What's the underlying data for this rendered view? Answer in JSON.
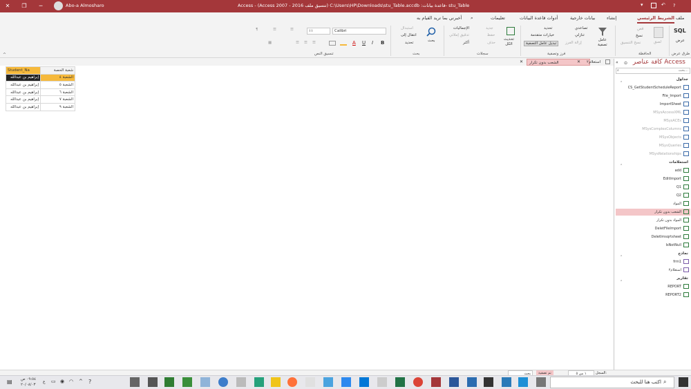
{
  "titlebar": {
    "title": "Access  -  (Access 2007 - 2016 تنسيق ملف) C:\\Users\\HP\\Downloads\\stu_Table.accdb :قاعدة بيانات- stu_Table",
    "user": "Abo-a Almosharo",
    "help": "?"
  },
  "menu": {
    "file": "ملف",
    "home": "الشريط الرئيسي",
    "create": "إنشاء",
    "external": "بيانات خارجية",
    "dbtools": "أدوات قاعدة البيانات",
    "help": "تعليمات",
    "tellme": "أخبرني بما تريد القيام به"
  },
  "ribbon": {
    "views": {
      "label": "طرق عرض",
      "view": "عرض",
      "sql": "SQL"
    },
    "clipboard": {
      "label": "الحافظة",
      "paste": "لصق",
      "cut": "قص",
      "copy": "نسخ",
      "format": "نسخ التنسيق"
    },
    "sortfilter": {
      "label": "فرز وتصفية",
      "filter": "عامل\nتصفية",
      "asc": "تصاعدي",
      "desc": "تنازلي",
      "remove_sort": "إزالة الفرز",
      "selection": "تحديد",
      "advanced": "خيارات متقدمة",
      "toggle": "تبديل عامل التصفية"
    },
    "records": {
      "label": "سجلات",
      "refresh": "تحديث\nالكل",
      "new": "جديد",
      "save": "حفظ",
      "delete": "حذف",
      "totals": "الإجماليات",
      "spelling": "تدقيق إملائي",
      "more": "أكثر"
    },
    "find": {
      "label": "بحث",
      "find": "بحث",
      "replace": "استبدال",
      "goto": "انتقال إلى",
      "select": "تحديد"
    },
    "textformat": {
      "label": "تنسيق النص",
      "font": "Calibri",
      "size": "١١"
    }
  },
  "doctabs": {
    "tab1": "الشعب بدون تكرار",
    "tab2": "استعلام٢"
  },
  "table": {
    "headers": [
      "Student_Na",
      "شعبة الحصة"
    ],
    "rows": [
      [
        "إبراهيم بن عبدالله",
        "الشعبة ٤"
      ],
      [
        "إبراهيم بن عبدالله",
        "الشعبة ٥"
      ],
      [
        "إبراهيم بن عبدالله",
        "الشعبة ٦"
      ],
      [
        "إبراهيم بن عبدالله",
        "الشعبة ٧"
      ],
      [
        "إبراهيم بن عبدالله",
        "الشعبة ٩"
      ]
    ]
  },
  "nav": {
    "title": "كافة عناصر Access",
    "search": "بحث...",
    "sections": {
      "tables": "جداول",
      "queries": "استعلامات",
      "forms": "نماذج",
      "reports": "تقارير"
    },
    "tables": [
      "CS_GetStudentScheduleReport",
      "File_Import",
      "ImportSheet",
      "MSysAccessXML",
      "MSysACEs",
      "MSysComplexColumns",
      "MSysObjects",
      "MSysQueries",
      "MSysRelationships"
    ],
    "queries": [
      "add",
      "EditImport",
      "Q1",
      "Q2",
      "المواد",
      "الشعب بدون تكرار",
      "المواد بدون تكرار",
      "DeletFileImport",
      "DeletImsqrtsheet",
      "IsNotNull"
    ],
    "forms": [
      "frm1",
      "استعلام٢"
    ],
    "reports": [
      "REPORT",
      "REPORT2"
    ]
  },
  "status": {
    "record": "السجل:",
    "of": "١ من ٥",
    "nofilter": "تم تصفية",
    "search": "بحث"
  },
  "taskbar": {
    "search": "اكتب هنا للبحث",
    "time": "٠٩:٥٤ ص",
    "date": "٢٠/٠٨/٠٣",
    "lang": "ع"
  },
  "colors": {
    "accent": "#a4373a",
    "selected": "#f4c6c8",
    "highlight": "#f6b93b"
  }
}
